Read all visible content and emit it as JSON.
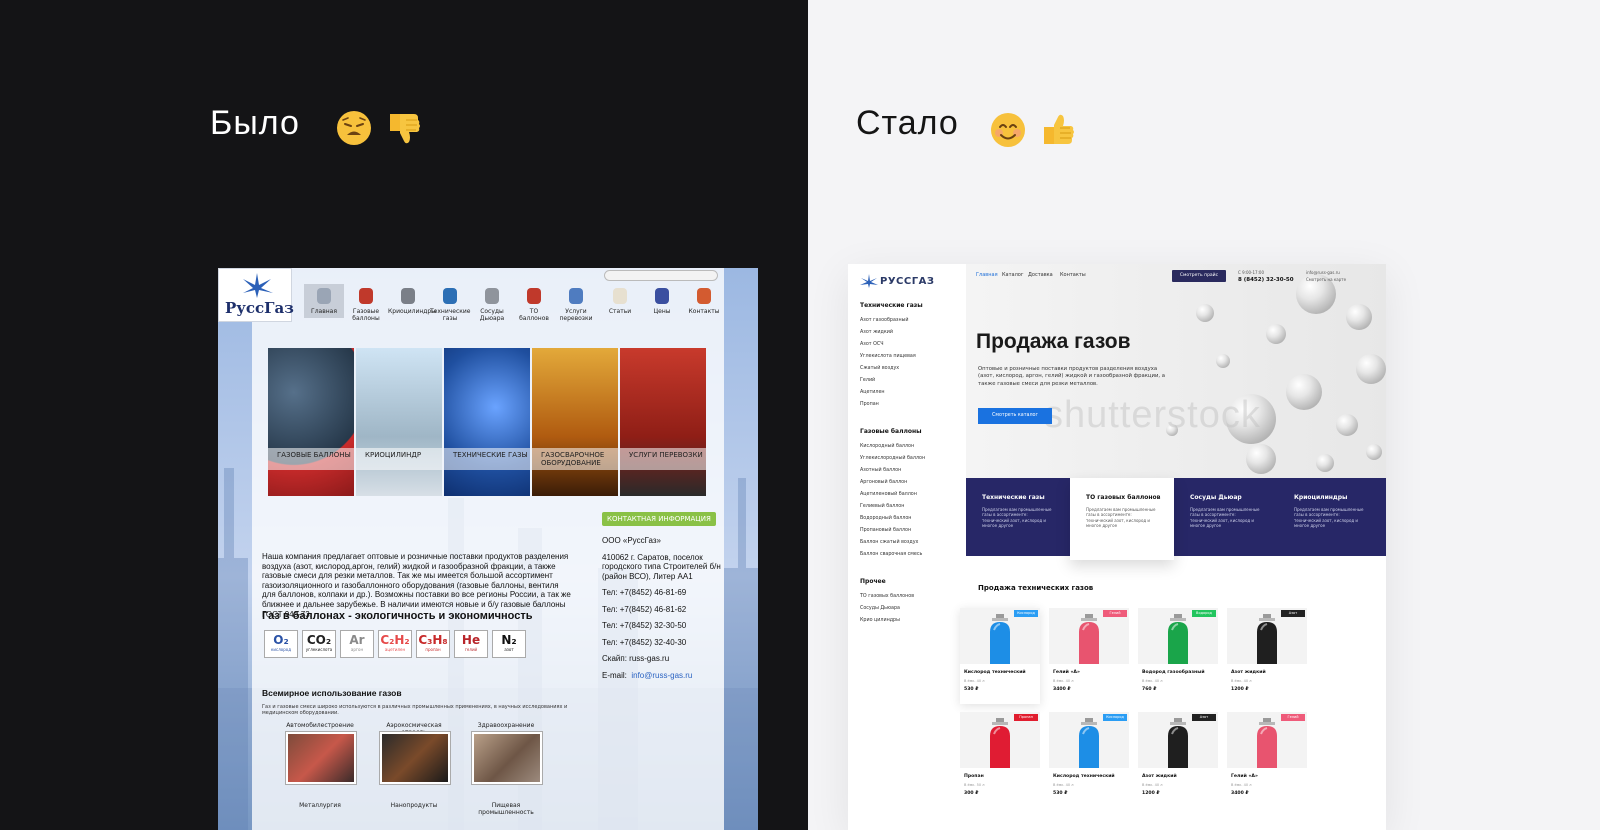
{
  "before": {
    "heading": "Было",
    "emoji": [
      "weary-face-emoji",
      "thumbs-down-emoji"
    ]
  },
  "after": {
    "heading": "Стало",
    "emoji": [
      "smiling-face-emoji",
      "thumbs-up-emoji"
    ]
  },
  "old_site": {
    "logo": "РуссГаз",
    "nav": [
      "Главная",
      "Газовые баллоны",
      "Криоцилиндры",
      "Технические газы",
      "Сосуды Дьюара",
      "ТО баллонов",
      "Услуги перевозки",
      "Статьи",
      "Цены",
      "Контакты"
    ],
    "tiles": [
      "ГАЗОВЫЕ БАЛЛОНЫ",
      "КРИОЦИЛИНДР",
      "ТЕХНИЧЕСКИЕ ГАЗЫ",
      "ГАЗОСВАРОЧНОЕ ОБОРУДОВАНИЕ",
      "УСЛУГИ ПЕРЕВОЗКИ"
    ],
    "contact_badge": "КОНТАКТНАЯ ИНФОРМАЦИЯ",
    "intro": "Наша компания предлагает оптовые и розничные поставки продуктов разделения воздуха (азот, кислород,аргон, гелий) жидкой и газообразной фракции, а также газовые смеси для резки металлов. Так же мы имеется большой ассортимент газоизоляционного и газобаллонного оборудования (газовые баллоны, вентиля для баллонов, колпаки и др.). Возможны поставки во все регионы России, а так же ближнее и дальнее зарубежье. В наличии имеются новые и б/у газовые баллоны ГОСТ 949-73.",
    "subheading": "Газ в баллонах - экологичность и экономичность",
    "gases": [
      {
        "symbol": "O₂",
        "name": "кислород",
        "color": "#2a52a6"
      },
      {
        "symbol": "CO₂",
        "name": "углекислота",
        "color": "#222222"
      },
      {
        "symbol": "Ar",
        "name": "аргон",
        "color": "#8a8a8a"
      },
      {
        "symbol": "C₂H₂",
        "name": "ацетилен",
        "color": "#e64a4a"
      },
      {
        "symbol": "C₃H₈",
        "name": "пропан",
        "color": "#c72a2a"
      },
      {
        "symbol": "He",
        "name": "гелий",
        "color": "#b8252a"
      },
      {
        "symbol": "N₂",
        "name": "азот",
        "color": "#111111"
      }
    ],
    "contacts": {
      "company": "ООО «РуссГаз»",
      "address": "410062 г. Саратов, поселок городского типа Строителей б/н (район ВСО), Литер АА1",
      "phones": [
        "Тел: +7(8452) 46-81-69",
        "Тел: +7(8452) 46-81-62",
        "Тел: +7(8452) 32-30-50",
        "Тел: +7(8452) 32-40-30"
      ],
      "skype": "Скайп: russ-gas.ru",
      "email_label": "E-mail:",
      "email": "info@russ-gas.ru"
    },
    "usage_title": "Всемирное использование газов",
    "usage_text": "Газ и газовые смеси широко используются в различных промышленных применениях, в научных исследованиях и медицинском оборудовании.",
    "sectors": [
      "Автомобилестроение",
      "Аэрокосмическая отрасль",
      "Здравоохранение",
      "Металлургия",
      "Нанопродукты",
      "Пищевая промышленность"
    ]
  },
  "new_site": {
    "logo": "РУССГАЗ",
    "nav": [
      "Главная",
      "Каталог",
      "Доставка",
      "Контакты"
    ],
    "cta": "Смотреть прайс",
    "phone_label": "С 9:00-17:00",
    "phone": "8 (8452) 32-30-50",
    "email": "info@russ-gas.ru",
    "email_sub": "Смотреть на карте",
    "sidebar": [
      {
        "title": "Технические газы",
        "items": [
          "Азот газообразный",
          "Азот жидкий",
          "Азот ОСЧ",
          "Углекислота пищевая",
          "Сжатый воздух",
          "Гелий",
          "Ацетилен",
          "Пропан"
        ]
      },
      {
        "title": "Газовые баллоны",
        "items": [
          "Кислородный баллон",
          "Углекислородный баллон",
          "Азотный баллон",
          "Аргоновый баллон",
          "Ацетиленовый баллон",
          "Гелиевый баллон",
          "Водородный баллон",
          "Пропановый баллон",
          "Баллон сжатый воздух",
          "Баллон сварочная смесь"
        ]
      },
      {
        "title": "Прочее",
        "items": [
          "ТО газовых баллонов",
          "Сосуды Дьюара",
          "Крио цилиндры"
        ]
      }
    ],
    "hero_title": "Продажа газов",
    "hero_desc": "Оптовые и розничные поставки продуктов разделения воздуха (азот, кислород, аргон, гелий) жидкой и газообразной фракции, а также газовые смеси для резки металлов.",
    "hero_button": "Смотреть каталог",
    "watermark": "shutterstock",
    "strip": [
      {
        "title": "Технические газы",
        "desc": "Предлагаем вам промышленные газы в ассортименте: технический азот, кислород и многое другое"
      },
      {
        "title": "ТО газовых баллонов",
        "desc": "Предлагаем вам промышленные газы в ассортименте: технический азот, кислород и многое другое"
      },
      {
        "title": "Сосуды Дьюар",
        "desc": "Предлагаем вам промышленные газы в ассортименте: технический азот, кислород и многое другое"
      },
      {
        "title": "Криоцилиндры",
        "desc": "Предлагаем вам промышленные газы в ассортименте: технический азот, кислород и многое другое"
      }
    ],
    "products_title": "Продажа технических газов",
    "products": [
      {
        "name": "Кислород технический",
        "sub": "В ёмк. 40 л",
        "price": "530 ₽",
        "tag": "Кислород",
        "tag_color": "#2a9df4",
        "color": "#1d8ee6"
      },
      {
        "name": "Гелий «А»",
        "sub": "В ёмк. 40 л",
        "price": "3400 ₽",
        "tag": "Гелий",
        "tag_color": "#ef5b7a",
        "color": "#e8546f"
      },
      {
        "name": "Водород газообразный",
        "sub": "В ёмк. 40 л",
        "price": "760 ₽",
        "tag": "Водород",
        "tag_color": "#22c55e",
        "color": "#1aa54a"
      },
      {
        "name": "Азот жидкий",
        "sub": "В ёмк. 40 л",
        "price": "1200 ₽",
        "tag": "Азот",
        "tag_color": "#222222",
        "color": "#1f1f1f"
      },
      {
        "name": "Пропан",
        "sub": "В ёмк. 50 л",
        "price": "300 ₽",
        "tag": "Пропан",
        "tag_color": "#e11d2e",
        "color": "#e01c33"
      },
      {
        "name": "Кислород технический",
        "sub": "В ёмк. 40 л",
        "price": "530 ₽",
        "tag": "Кислород",
        "tag_color": "#2a9df4",
        "color": "#1d8ee6"
      },
      {
        "name": "Азот жидкий",
        "sub": "В ёмк. 40 л",
        "price": "1200 ₽",
        "tag": "Азот",
        "tag_color": "#222222",
        "color": "#1f1f1f"
      },
      {
        "name": "Гелий «А»",
        "sub": "В ёмк. 40 л",
        "price": "3400 ₽",
        "tag": "Гелий",
        "tag_color": "#ef5b7a",
        "color": "#e8546f"
      }
    ]
  }
}
